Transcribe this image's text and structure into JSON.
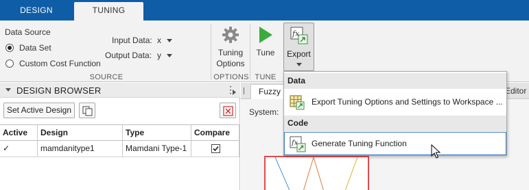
{
  "tabs": [
    {
      "label": "DESIGN",
      "active": false
    },
    {
      "label": "TUNING",
      "active": true
    }
  ],
  "toolstrip": {
    "source": {
      "data_source_label": "Data Source",
      "radio_data_set": "Data Set",
      "radio_custom_cost": "Custom Cost Function",
      "selected": "Data Set",
      "input_data_label": "Input Data:",
      "input_data_value": "x",
      "output_data_label": "Output Data:",
      "output_data_value": "y",
      "section_label": "SOURCE"
    },
    "options": {
      "button_line1": "Tuning",
      "button_line2": "Options",
      "section_label": "OPTIONS"
    },
    "tune": {
      "button_label": "Tune",
      "section_label": "TUNE"
    },
    "export": {
      "button_label": "Export"
    }
  },
  "design_browser": {
    "title": "DESIGN BROWSER",
    "set_active_button": "Set Active Design",
    "table": {
      "columns": [
        "Active",
        "Design",
        "Type",
        "Compare"
      ],
      "rows": [
        {
          "active": "✓",
          "design": "mamdanitype1",
          "type": "Mamdani Type-1",
          "compare": true
        }
      ]
    }
  },
  "document": {
    "tab_label": "Fuzzy",
    "right_tab_partial": "Editor",
    "system_label": "System:"
  },
  "export_menu": {
    "section_data": "Data",
    "item_export_workspace": "Export Tuning Options and Settings to Workspace ...",
    "section_code": "Code",
    "item_generate_function": "Generate Tuning Function"
  },
  "colors": {
    "tabbar": "#0e5da6",
    "toolstrip": "#f2f2f2",
    "accent_blue": "#3d7dc6",
    "tune_green": "#3cab3c",
    "plot_red": "#e34a4a"
  },
  "icons": {
    "gear": "gear-icon",
    "play": "play-icon",
    "fx_export": "fx-export-icon",
    "copy": "copy-icon",
    "delete": "delete-icon",
    "grid_export": "grid-export-icon"
  }
}
